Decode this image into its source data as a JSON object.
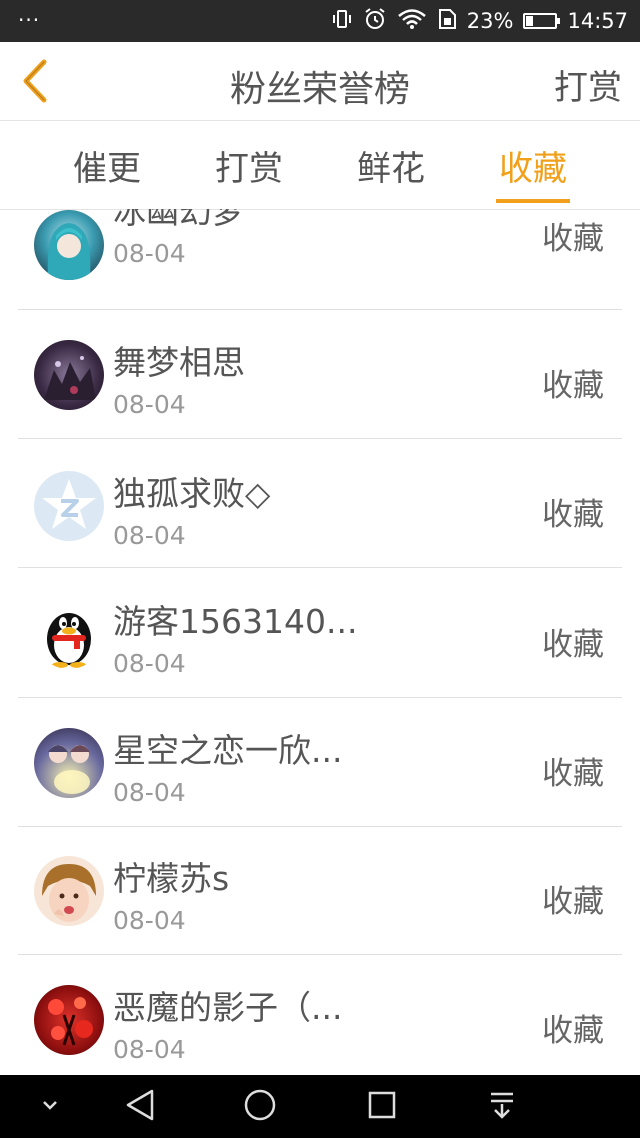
{
  "status_bar": {
    "left_dots": "···",
    "battery_percent": "23%",
    "battery_level": 0.23,
    "time": "14:57",
    "icons": [
      "vibrate-icon",
      "alarm-icon",
      "wifi-icon",
      "sim-icon",
      "battery-icon"
    ]
  },
  "header": {
    "back_icon": "chevron-left-icon",
    "title": "粉丝荣誉榜",
    "action_label": "打赏"
  },
  "tabs": [
    {
      "label": "催更",
      "active": false
    },
    {
      "label": "打赏",
      "active": false
    },
    {
      "label": "鲜花",
      "active": false
    },
    {
      "label": "收藏",
      "active": true
    }
  ],
  "accent_color": "#f0a01a",
  "list": [
    {
      "name": "冰幽幻梦",
      "date": "08-04",
      "status": "收藏",
      "avatar": "anime-girl-avatar"
    },
    {
      "name": "舞梦相思",
      "date": "08-04",
      "status": "收藏",
      "avatar": "dark-scene-avatar"
    },
    {
      "name": "独孤求败◇",
      "date": "08-04",
      "status": "收藏",
      "avatar": "qzone-star-avatar"
    },
    {
      "name": "游客1563140...",
      "date": "08-04",
      "status": "收藏",
      "avatar": "penguin-avatar"
    },
    {
      "name": "星空之恋一欣...",
      "date": "08-04",
      "status": "收藏",
      "avatar": "anime-couple-avatar"
    },
    {
      "name": "柠檬苏s",
      "date": "08-04",
      "status": "收藏",
      "avatar": "child-photo-avatar"
    },
    {
      "name": "恶魔的影子（...",
      "date": "08-04",
      "status": "收藏",
      "avatar": "red-flowers-avatar"
    }
  ],
  "nav_bar": {
    "icons": [
      "chevron-down-icon",
      "back-triangle-icon",
      "home-circle-icon",
      "recents-square-icon",
      "notification-pull-icon"
    ]
  }
}
